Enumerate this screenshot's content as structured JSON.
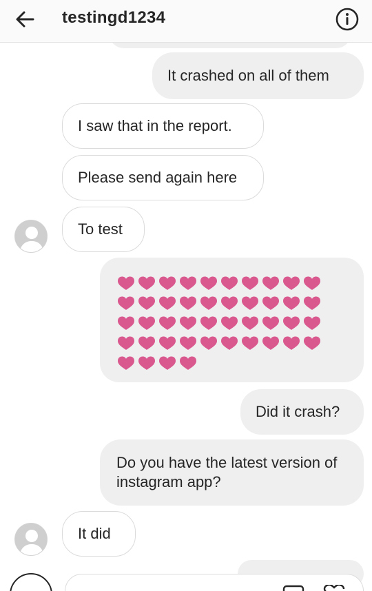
{
  "header": {
    "back_icon": "arrow-left-icon",
    "title": "testingd1234",
    "info_icon": "info-circle-icon"
  },
  "messages": [
    {
      "direction": "outgoing",
      "text": "It crashed on all of them"
    },
    {
      "direction": "incoming",
      "text": "I saw that in the report."
    },
    {
      "direction": "incoming",
      "text": "Please send again here"
    },
    {
      "direction": "incoming",
      "text": "To test"
    },
    {
      "direction": "outgoing",
      "hearts_count": 44,
      "emoji_name": "pink-heart-emoji"
    },
    {
      "direction": "outgoing",
      "text": "Did it crash?"
    },
    {
      "direction": "outgoing",
      "text": "Do you have the latest version of instagram app?"
    },
    {
      "direction": "incoming",
      "text": "It  did"
    }
  ],
  "colors": {
    "heart": "#d9598f",
    "outgoing_bubble": "#efefef",
    "incoming_border": "#dbdbdb",
    "text": "#262626"
  },
  "composer": {
    "gallery_icon": "gallery-icon",
    "heart_icon": "heart-outline-icon"
  }
}
